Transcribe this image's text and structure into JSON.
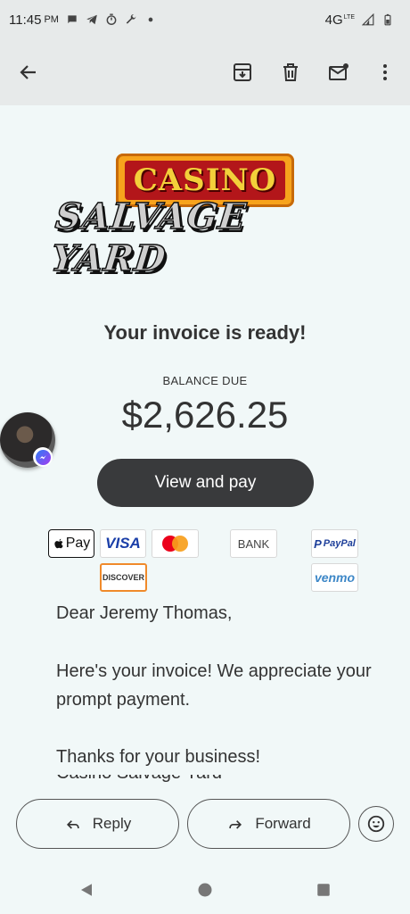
{
  "status_bar": {
    "time": "11:45",
    "ampm": "PM",
    "icons": [
      "chat-bubble-icon",
      "telegram-icon",
      "timer-icon",
      "wrench-icon",
      "dot-icon"
    ],
    "network": "4G",
    "network_sub": "LTE",
    "right_icons": [
      "signal-icon",
      "battery-icon"
    ]
  },
  "toolbar": {
    "back": "arrow-back-icon",
    "actions": [
      "archive-icon",
      "delete-icon",
      "mark-unread-icon",
      "more-vert-icon"
    ]
  },
  "logo": {
    "top_text": "CASINO",
    "bottom_text": "SALVAGE YARD"
  },
  "invoice": {
    "heading": "Your invoice is ready!",
    "balance_label": "BALANCE DUE",
    "balance_amount": "$2,626.25",
    "pay_button": "View and pay"
  },
  "payment_methods": {
    "apple_pay": "Pay",
    "visa": "VISA",
    "mastercard": "mastercard-logo",
    "bank": "BANK",
    "paypal": "PayPal",
    "discover": "DISCOVER",
    "venmo": "venmo"
  },
  "message": {
    "greeting": "Dear Jeremy Thomas,",
    "line1": "Here's your invoice! We appreciate your prompt payment.",
    "thanks": "Thanks for your business!",
    "signature_partial": "Casino Salvage Yard"
  },
  "actions": {
    "reply": "Reply",
    "forward": "Forward",
    "emoji": "emoji-reaction-icon"
  },
  "colors": {
    "background": "#f1f8f8",
    "bar": "#e7eaea",
    "pay_button": "#393a3c",
    "visa_blue": "#1a3ea8",
    "mastercard_red": "#eb001b",
    "mastercard_orange": "#f79e1b",
    "messenger_blue": "#2d7cf6"
  },
  "nav": [
    "back-nav-icon",
    "home-nav-icon",
    "recents-nav-icon"
  ]
}
